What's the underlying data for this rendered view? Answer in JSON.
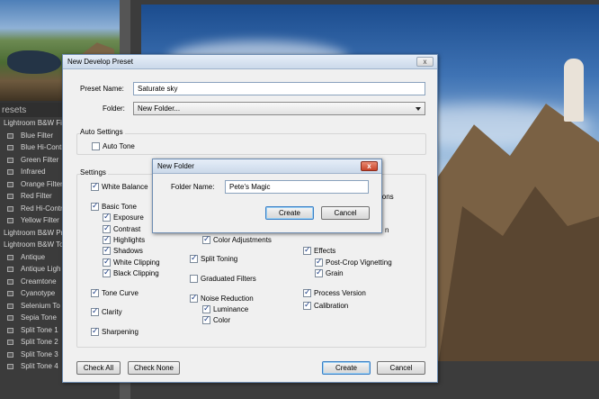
{
  "lightroom": {
    "presets_header": "resets",
    "presets": [
      {
        "label": "Lightroom B&W Fi",
        "kind": "folder"
      },
      {
        "label": "Blue Filter",
        "kind": "child"
      },
      {
        "label": "Blue Hi-Contr",
        "kind": "child"
      },
      {
        "label": "Green Filter",
        "kind": "child"
      },
      {
        "label": "Infrared",
        "kind": "child"
      },
      {
        "label": "Orange Filter",
        "kind": "child"
      },
      {
        "label": "Red Filter",
        "kind": "child"
      },
      {
        "label": "Red Hi-Contr",
        "kind": "child"
      },
      {
        "label": "Yellow Filter",
        "kind": "child"
      },
      {
        "label": "Lightroom B&W Pr",
        "kind": "folder"
      },
      {
        "label": "Lightroom B&W To",
        "kind": "folder"
      },
      {
        "label": "Antique",
        "kind": "child"
      },
      {
        "label": "Antique Ligh",
        "kind": "child"
      },
      {
        "label": "Creamtone",
        "kind": "child"
      },
      {
        "label": "Cyanotype",
        "kind": "child"
      },
      {
        "label": "Selenium To",
        "kind": "child"
      },
      {
        "label": "Sepia Tone",
        "kind": "child"
      },
      {
        "label": "Split Tone 1",
        "kind": "child"
      },
      {
        "label": "Split Tone 2",
        "kind": "child"
      },
      {
        "label": "Split Tone 3",
        "kind": "child"
      },
      {
        "label": "Split Tone 4",
        "kind": "child"
      }
    ]
  },
  "preset_dialog": {
    "title": "New Develop Preset",
    "close": "x",
    "preset_name_label": "Preset Name:",
    "preset_name_value": "Saturate sky",
    "folder_label": "Folder:",
    "folder_value": "New Folder...",
    "auto_settings_label": "Auto Settings",
    "auto_tone": "Auto Tone",
    "settings_label": "Settings",
    "white_balance": "White Balance",
    "basic_tone": "Basic Tone",
    "exposure": "Exposure",
    "contrast": "Contrast",
    "highlights": "Highlights",
    "shadows": "Shadows",
    "white_clipping": "White Clipping",
    "black_clipping": "Black Clipping",
    "tone_curve": "Tone Curve",
    "clarity": "Clarity",
    "sharpening": "Sharpening",
    "color_adjustments": "Color Adjustments",
    "split_toning": "Split Toning",
    "graduated_filters": "Graduated Filters",
    "noise_reduction": "Noise Reduction",
    "luminance": "Luminance",
    "color": "Color",
    "partial_right_1": "ions",
    "partial_right_2": "n",
    "effects": "Effects",
    "post_crop_vignetting": "Post-Crop Vignetting",
    "grain": "Grain",
    "process_version": "Process Version",
    "calibration": "Calibration",
    "check_all": "Check All",
    "check_none": "Check None",
    "create": "Create",
    "cancel": "Cancel"
  },
  "folder_dialog": {
    "title": "New Folder",
    "close": "x",
    "folder_name_label": "Folder Name:",
    "folder_name_value": "Pete's Magic",
    "create": "Create",
    "cancel": "Cancel"
  },
  "checkbox_states": {
    "auto_tone": false,
    "white_balance": true,
    "basic_tone": true,
    "exposure": true,
    "contrast": true,
    "highlights": true,
    "shadows": true,
    "white_clipping": true,
    "black_clipping": true,
    "tone_curve": true,
    "clarity": true,
    "sharpening": true,
    "color_adjustments": true,
    "split_toning": true,
    "graduated_filters": false,
    "noise_reduction": true,
    "luminance": true,
    "color": true,
    "effects": true,
    "post_crop_vignetting": true,
    "grain": true,
    "process_version": true,
    "calibration": true
  },
  "colors": {
    "dialog_bg": "#f0f0f0",
    "titlebar": "#cbd9ea",
    "close_red": "#c8442a",
    "default_button_border": "#3a7fc6"
  }
}
